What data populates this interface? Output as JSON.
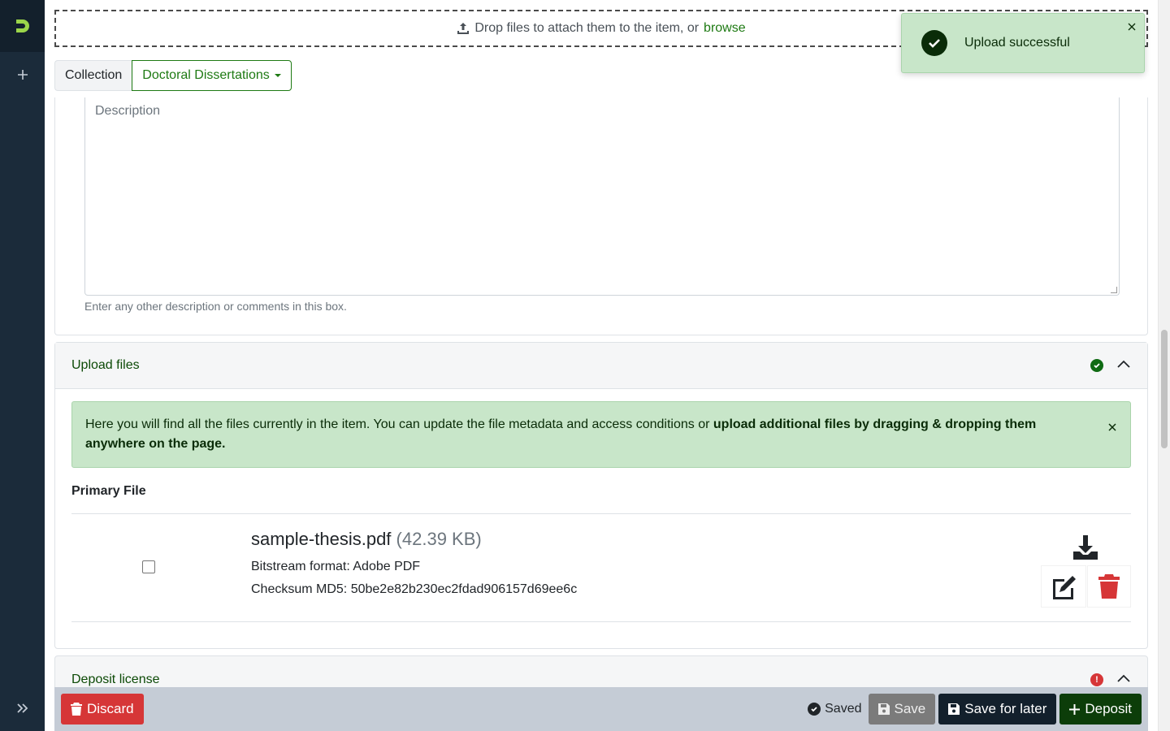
{
  "dropzone": {
    "text": "Drop files to attach them to the item, or",
    "browse": "browse"
  },
  "collection": {
    "label": "Collection",
    "value": "Doctoral Dissertations"
  },
  "description": {
    "placeholder": "Description",
    "help": "Enter any other description or comments in this box."
  },
  "upload": {
    "title": "Upload files",
    "alert_text": "Here you will find all the files currently in the item. You can update the file metadata and access conditions or ",
    "alert_bold": "upload additional files by dragging & dropping them anywhere on the page.",
    "primary_label": "Primary File",
    "file": {
      "name": "sample-thesis.pdf",
      "size": "(42.39 KB)",
      "format": "Bitstream format: Adobe PDF",
      "md5": "Checksum MD5: 50be2e82b230ec2fdad906157d69ee6c"
    }
  },
  "license": {
    "title": "Deposit license"
  },
  "footer": {
    "discard": "Discard",
    "saved": "Saved",
    "save": "Save",
    "save_later": "Save for later",
    "deposit": "Deposit"
  },
  "toast": {
    "message": "Upload successful"
  },
  "colors": {
    "accent": "#1e7a13",
    "danger": "#d63637",
    "sidebar": "#1b2b3a"
  }
}
